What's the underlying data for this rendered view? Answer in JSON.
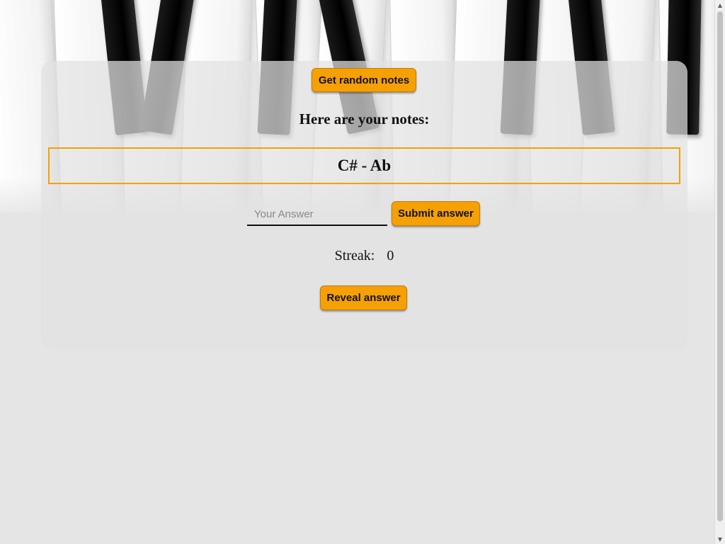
{
  "buttons": {
    "random_notes": "Get random notes",
    "submit": "Submit answer",
    "reveal": "Reveal answer"
  },
  "notes": {
    "heading": "Here are your notes:",
    "value": "C# - Ab"
  },
  "answer": {
    "placeholder": "Your Answer",
    "value": ""
  },
  "streak": {
    "label": "Streak:",
    "value": "0"
  },
  "colors": {
    "accent": "#f5a005",
    "background": "#e5e5e5"
  }
}
